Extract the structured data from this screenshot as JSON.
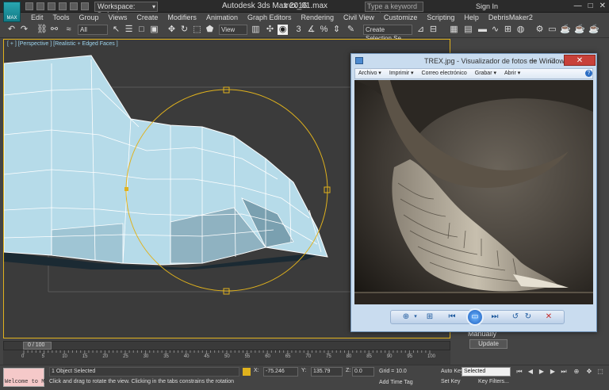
{
  "app": {
    "title": "Autodesk 3ds Max 2016",
    "file": "trex_01.max",
    "logo_text": "MAX",
    "workspace": "Workspace: Default",
    "search_placeholder": "Type a keyword or phrase",
    "sign_in": "Sign In",
    "window_buttons": {
      "minimize": "—",
      "maximize": "□",
      "close": "✕"
    }
  },
  "menu": [
    "Edit",
    "Tools",
    "Group",
    "Views",
    "Create",
    "Modifiers",
    "Animation",
    "Graph Editors",
    "Rendering",
    "Civil View",
    "Customize",
    "Scripting",
    "Help",
    "DebrisMaker2"
  ],
  "toolbar": {
    "filter": "All",
    "ref_coord": "View",
    "selection_set": "Create Selection Se",
    "snap_value": "3"
  },
  "viewport": {
    "label": "[ + ] [Perspective ] [Realistic + Edged Faces ]",
    "accent": "#e0b21d",
    "mesh_color": "#b6dbe9",
    "wire_color": "#ffffff",
    "gizmo_color": "#e0b21d"
  },
  "photo_viewer": {
    "title": "TREX.jpg - Visualizador de fotos de Windows",
    "menus": [
      "Archivo ▾",
      "Imprimir ▾",
      "Correo electrónico",
      "Grabar ▾",
      "Abrir ▾"
    ],
    "help": "?",
    "controls": {
      "zoom": "⊕",
      "zoom_caret": "▾",
      "fit": "⊞",
      "prev": "⏮",
      "slideshow": "▭",
      "next": "⏭",
      "rotate_left": "↺",
      "rotate_right": "↻",
      "delete": "✕"
    }
  },
  "command_panel": {
    "manually": "Manually",
    "update": "Update"
  },
  "timeline": {
    "frame_label": "0 / 100",
    "ticks": [
      "0",
      "5",
      "10",
      "15",
      "20",
      "25",
      "30",
      "35",
      "40",
      "45",
      "50",
      "55",
      "60",
      "65",
      "70",
      "75",
      "80",
      "85",
      "90",
      "95",
      "100"
    ]
  },
  "status": {
    "maxscript": "Welcome to M",
    "objects_selected": "1 Object Selected",
    "prompt": "Click and drag to rotate the view.  Clicking in the tabs constrains the rotation",
    "x_label": "X:",
    "x_value": "-75.246",
    "y_label": "Y:",
    "y_value": "135.79",
    "z_label": "Z:",
    "z_value": "0.0",
    "grid": "Grid = 10.0",
    "add_time_tag": "Add Time Tag",
    "auto_key": "Auto Key",
    "set_key": "Set Key",
    "selected": "Selected",
    "key_filters": "Key Filters..."
  }
}
